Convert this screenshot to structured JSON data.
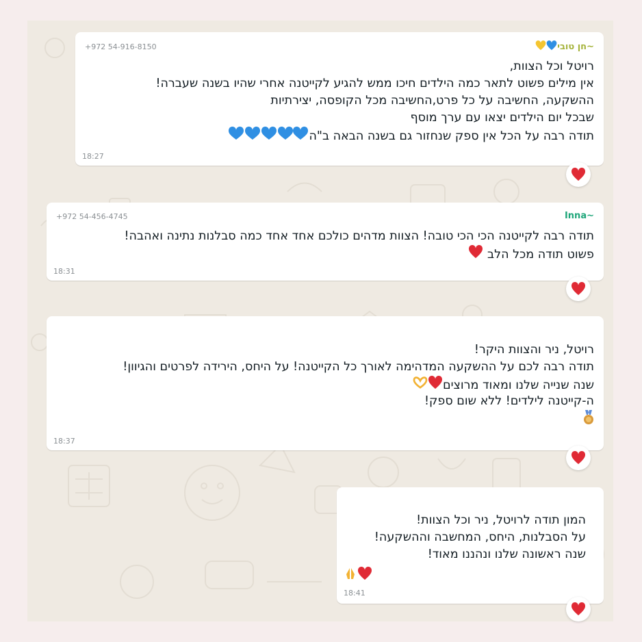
{
  "messages": [
    {
      "phone": "+972 54-916-8150",
      "sender": "~חן טובי",
      "lines": [
        "רויטל וכל הצוות,",
        "אין מילים פשוט לתאר כמה הילדים חיכו ממש להגיע לקייטנה אחרי שהיו בשנה שעברה!",
        "ההשקעה, החשיבה על כל פרט,החשיבה מכל הקופסה, יצירתיות",
        "שבכל יום הילדים יצאו עם ערך מוסף",
        "תודה רבה על הכל אין ספק שנחזור גם בשנה הבאה ב\"ה"
      ],
      "time": "18:27",
      "reaction": "red-heart"
    },
    {
      "phone": "+972 54-456-4745",
      "sender": "~Inna",
      "lines": [
        "תודה רבה לקייטנה הכי הכי טובה! הצוות מדהים כולכם אחד אחד כמה סבלנות נתינה ואהבה!",
        "פשוט תודה מכל הלב"
      ],
      "time": "18:31",
      "reaction": "red-heart"
    },
    {
      "lines": [
        "רויטל, ניר והצוות היקר!",
        "תודה רבה לכם על ההשקעה המדהימה לאורך כל הקייטנה! על היחס, הירידה לפרטים והגיוון!",
        "שנה שנייה שלנו ומאוד מרוצים",
        "ה-קייטנה לילדים! ללא שום ספק!"
      ],
      "time": "18:37",
      "reaction": "red-heart"
    },
    {
      "lines": [
        "המון תודה לרויטל, ניר וכל הצוות!",
        "על הסבלנות, היחס, המחשבה וההשקעה!",
        "שנה ראשונה שלנו ונהננו מאוד!"
      ],
      "time": "18:41",
      "reaction": "red-heart"
    }
  ],
  "colors": {
    "background": "#efeae2",
    "bubble": "#ffffff",
    "sender_1": "#a5b33a",
    "sender_2": "#1fa67a",
    "meta": "#8a8f93",
    "heart": "#e02a35",
    "blue_heart": "#2f8fe3",
    "yellow_heart": "#f5c530"
  }
}
